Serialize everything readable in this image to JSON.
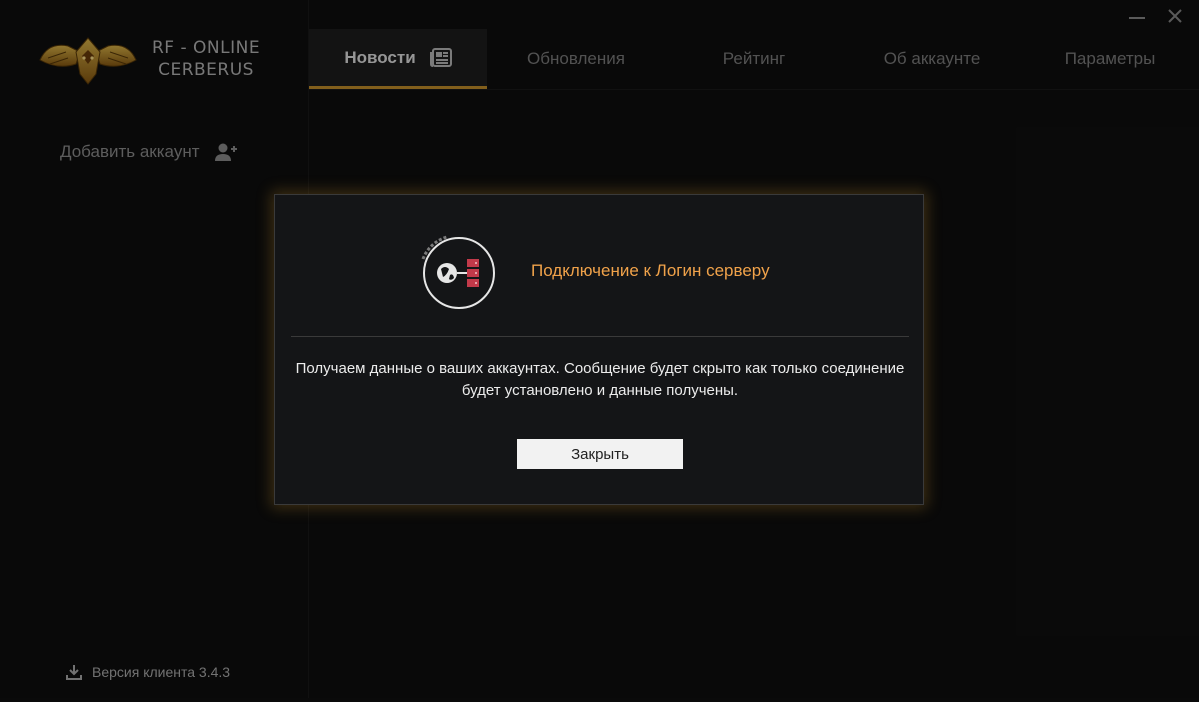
{
  "brand": {
    "line1": "RF - ONLINE",
    "line2": "CERBERUS"
  },
  "window": {
    "minimize": "minimize-icon",
    "close": "close-icon"
  },
  "tabs": [
    {
      "label": "Новости",
      "active": true,
      "icon": "newspaper-icon"
    },
    {
      "label": "Обновления",
      "active": false
    },
    {
      "label": "Рейтинг",
      "active": false
    },
    {
      "label": "Об аккаунте",
      "active": false
    },
    {
      "label": "Параметры",
      "active": false
    }
  ],
  "sidebar": {
    "add_account_label": "Добавить аккаунт",
    "version_label": "Версия клиента 3.4.3"
  },
  "modal": {
    "title": "Подключение к Логин серверу",
    "message": "Получаем данные о ваших аккаунтах. Сообщение будет скрыто как только соединение будет установлено и данные получены.",
    "close_label": "Закрыть"
  },
  "colors": {
    "accent": "#c8922b",
    "title": "#f0a24a",
    "background": "#0f0f0f",
    "modal_bg": "#141517"
  }
}
